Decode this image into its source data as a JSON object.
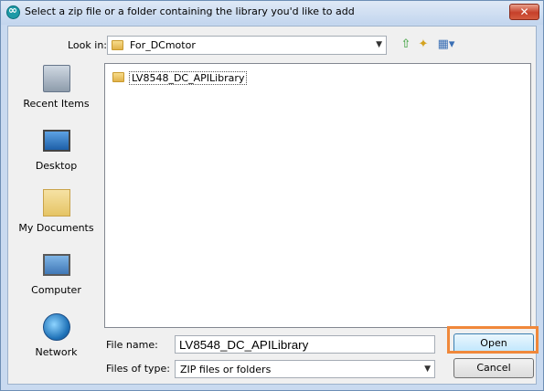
{
  "window": {
    "title": "Select a zip file or a folder containing the library you'd like to add",
    "close_label": "✕"
  },
  "toolbar": {
    "look_in_label": "Look in:",
    "look_in_value": "For_DCmotor",
    "icons": [
      "up-one-level-icon",
      "new-folder-icon",
      "view-menu-icon"
    ]
  },
  "places": [
    {
      "label": "Recent Items",
      "icon": "recent-items-icon"
    },
    {
      "label": "Desktop",
      "icon": "desktop-icon"
    },
    {
      "label": "My Documents",
      "icon": "my-documents-icon"
    },
    {
      "label": "Computer",
      "icon": "computer-icon"
    },
    {
      "label": "Network",
      "icon": "network-icon"
    }
  ],
  "files": [
    {
      "name": "LV8548_DC_APILibrary",
      "type": "folder"
    }
  ],
  "form": {
    "file_name_label": "File name:",
    "file_name_value": "LV8548_DC_APILibrary",
    "file_type_label": "Files of type:",
    "file_type_value": "ZIP files or folders"
  },
  "buttons": {
    "open": "Open",
    "cancel": "Cancel"
  },
  "colors": {
    "highlight": "#f0883a",
    "title_bar": "#c9daf0",
    "close_button": "#c6402a"
  }
}
